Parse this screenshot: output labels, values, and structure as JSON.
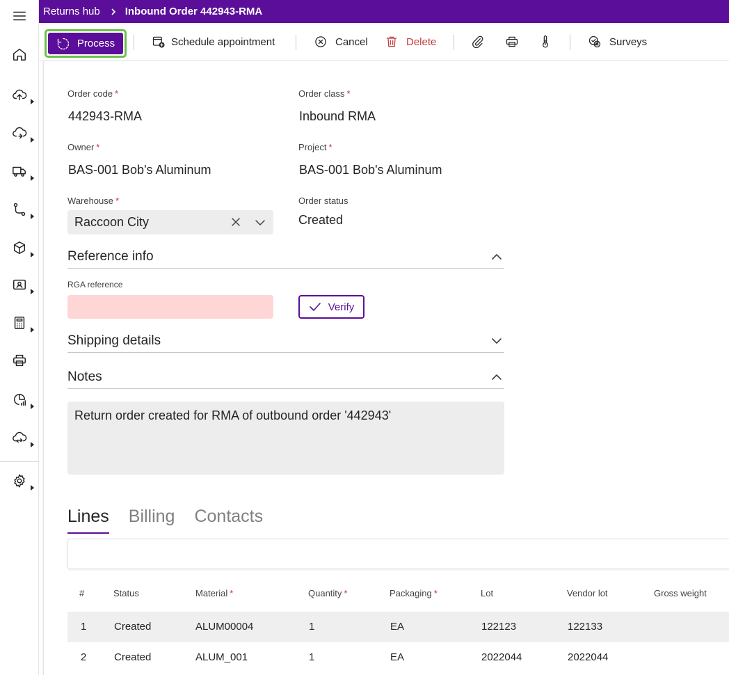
{
  "header": {
    "breadcrumb_parent": "Returns hub",
    "title": "Inbound Order 442943-RMA"
  },
  "toolbar": {
    "process": "Process",
    "schedule": "Schedule appointment",
    "cancel": "Cancel",
    "delete": "Delete",
    "surveys": "Surveys"
  },
  "rail": {
    "items": [
      "home",
      "upload",
      "cloud-sync",
      "truck",
      "flow",
      "box",
      "contact-card",
      "calculator",
      "printer",
      "analytics",
      "cloud-transfer",
      "settings"
    ]
  },
  "form": {
    "order_code_label": "Order code",
    "order_code": "442943-RMA",
    "order_class_label": "Order class",
    "order_class": "Inbound RMA",
    "owner_label": "Owner",
    "owner": "BAS-001 Bob's Aluminum",
    "project_label": "Project",
    "project": "BAS-001 Bob's Aluminum",
    "warehouse_label": "Warehouse",
    "warehouse": "Raccoon City",
    "order_status_label": "Order status",
    "order_status": "Created",
    "required_mark": "*"
  },
  "sections": {
    "reference_info": "Reference info",
    "rga_reference_label": "RGA reference",
    "rga_reference_value": "",
    "verify": "Verify",
    "shipping_details": "Shipping details",
    "notes": "Notes",
    "notes_text": "Return order created for RMA of outbound order '442943'"
  },
  "tabs": {
    "lines": "Lines",
    "billing": "Billing",
    "contacts": "Contacts"
  },
  "grid": {
    "columns": {
      "num": "#",
      "status": "Status",
      "material": "Material",
      "quantity": "Quantity",
      "packaging": "Packaging",
      "lot": "Lot",
      "vendor_lot": "Vendor lot",
      "gross_weight": "Gross weight"
    },
    "rows": [
      {
        "num": "1",
        "status": "Created",
        "material": "ALUM00004",
        "quantity": "1",
        "packaging": "EA",
        "lot": "122123",
        "vendor_lot": "122133",
        "gross_weight": ""
      },
      {
        "num": "2",
        "status": "Created",
        "material": "ALUM_001",
        "quantity": "1",
        "packaging": "EA",
        "lot": "2022044",
        "vendor_lot": "2022044",
        "gross_weight": ""
      }
    ]
  },
  "colors": {
    "brand_purple": "#5b0e99",
    "focus_green": "#6cc04a",
    "required_red": "#c4314b",
    "error_fill": "#ffd6d6",
    "delete_red": "#c13b3b"
  }
}
